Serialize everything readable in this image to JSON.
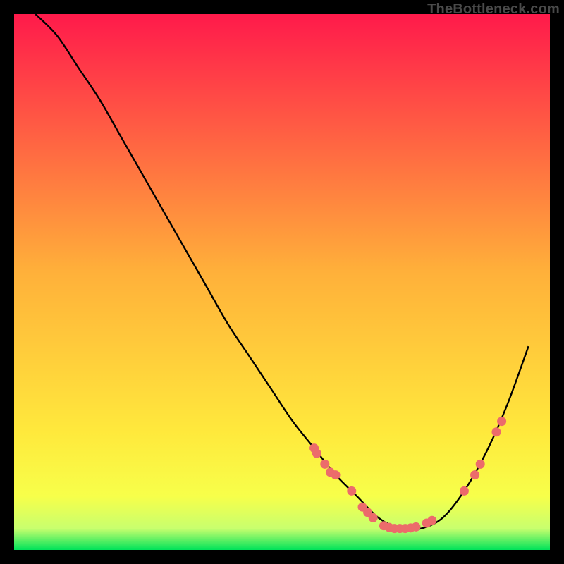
{
  "watermark": "TheBottleneck.com",
  "chart_data": {
    "type": "line",
    "title": "",
    "xlabel": "",
    "ylabel": "",
    "xlim": [
      0,
      100
    ],
    "ylim": [
      0,
      100
    ],
    "grid": false,
    "legend": false,
    "background_gradient": {
      "top_color": "#ff1a4b",
      "mid_color": "#ffe93c",
      "low_transition_color": "#f7ff4a",
      "pre_bottom_color": "#c8ff6e",
      "bottom_color": "#00e35a"
    },
    "curve": {
      "description": "Bottleneck V-shaped curve: high on left, drops to minimum around x≈72, rises toward right",
      "x": [
        4,
        8,
        12,
        16,
        20,
        24,
        28,
        32,
        36,
        40,
        44,
        48,
        52,
        56,
        60,
        64,
        68,
        72,
        76,
        80,
        84,
        88,
        92,
        96
      ],
      "y": [
        100,
        96,
        90,
        84,
        77,
        70,
        63,
        56,
        49,
        42,
        36,
        30,
        24,
        19,
        14,
        10,
        6,
        4,
        4,
        6,
        11,
        18,
        27,
        38
      ]
    },
    "markers": {
      "description": "Salmon circular markers on the curve, mostly near the minimum",
      "color": "#ec6b6b",
      "points": [
        {
          "x": 56,
          "y": 19
        },
        {
          "x": 56.5,
          "y": 18
        },
        {
          "x": 58,
          "y": 16
        },
        {
          "x": 59,
          "y": 14.5
        },
        {
          "x": 60,
          "y": 14
        },
        {
          "x": 63,
          "y": 11
        },
        {
          "x": 65,
          "y": 8
        },
        {
          "x": 66,
          "y": 7
        },
        {
          "x": 67,
          "y": 6
        },
        {
          "x": 69,
          "y": 4.5
        },
        {
          "x": 70,
          "y": 4.2
        },
        {
          "x": 71,
          "y": 4
        },
        {
          "x": 72,
          "y": 4
        },
        {
          "x": 73,
          "y": 4
        },
        {
          "x": 74,
          "y": 4.1
        },
        {
          "x": 75,
          "y": 4.3
        },
        {
          "x": 77,
          "y": 5
        },
        {
          "x": 78,
          "y": 5.5
        },
        {
          "x": 84,
          "y": 11
        },
        {
          "x": 86,
          "y": 14
        },
        {
          "x": 87,
          "y": 16
        },
        {
          "x": 90,
          "y": 22
        },
        {
          "x": 91,
          "y": 24
        }
      ]
    }
  }
}
